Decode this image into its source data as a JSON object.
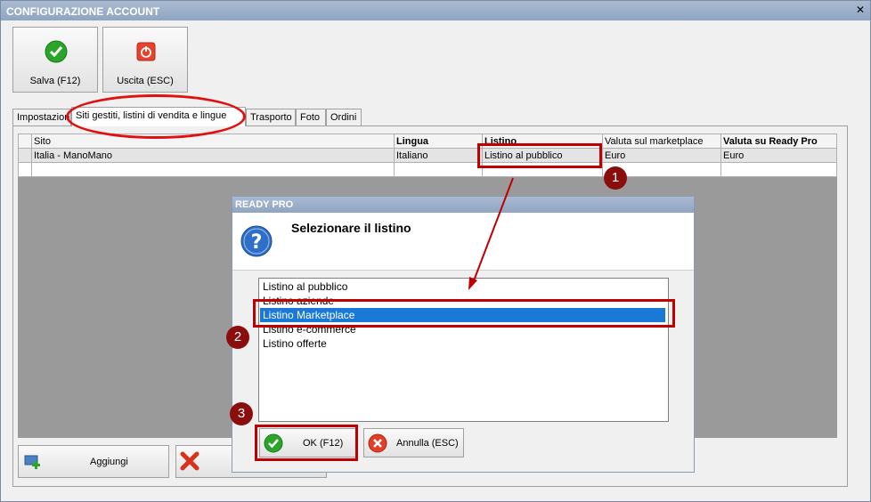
{
  "window": {
    "title": "CONFIGURAZIONE ACCOUNT",
    "close_glyph": "✕"
  },
  "toolbar": {
    "save_label": "Salva (F12)",
    "exit_label": "Uscita (ESC)"
  },
  "tabs": [
    {
      "label": "Impostazioni"
    },
    {
      "label": "Siti gestiti, listini di vendita e lingue"
    },
    {
      "label": "Trasporto"
    },
    {
      "label": "Foto"
    },
    {
      "label": "Ordini"
    }
  ],
  "grid": {
    "headers": [
      "Sito",
      "Lingua",
      "Listino",
      "Valuta sul marketplace",
      "Valuta su Ready Pro"
    ],
    "rows": [
      [
        "Italia - ManoMano",
        "Italiano",
        "Listino al pubblico",
        "Euro",
        "Euro"
      ]
    ]
  },
  "bottom": {
    "add_label": "Aggiungi"
  },
  "dialog": {
    "title": "READY PRO",
    "question": "Selezionare il listino",
    "items": [
      "Listino al pubblico",
      "Listino aziende",
      "Listino Marketplace",
      "Listino e-commerce",
      "Listino offerte"
    ],
    "selected_index": 2,
    "ok_label": "OK (F12)",
    "cancel_label": "Annulla (ESC)"
  },
  "annotations": [
    "1",
    "2",
    "3"
  ],
  "colors": {
    "selection": "#1a78d6",
    "annotation": "#c00000",
    "title_bar": "#8fa5c2"
  }
}
